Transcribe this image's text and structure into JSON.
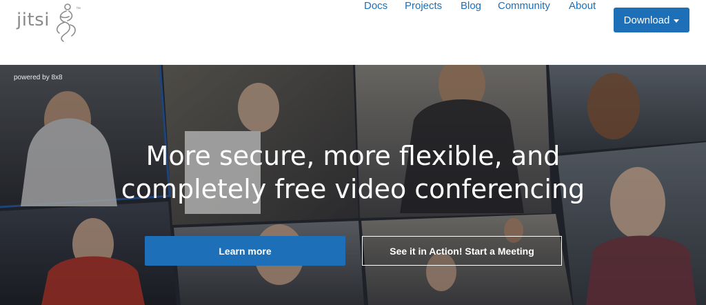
{
  "logo": {
    "text": "jitsi",
    "tm": "™"
  },
  "nav": {
    "items": [
      {
        "label": "Docs"
      },
      {
        "label": "Projects"
      },
      {
        "label": "Blog"
      },
      {
        "label": "Community"
      },
      {
        "label": "About"
      }
    ],
    "download_label": "Download"
  },
  "hero": {
    "powered_by": "powered by 8x8",
    "headline_line1": "More secure, more flexible, and",
    "headline_line2": "completely free video conferencing",
    "learn_more_label": "Learn more",
    "start_meeting_label": "See it in Action! Start a Meeting"
  },
  "colors": {
    "accent": "#1d6fb8",
    "logo_gray": "#8a8a8a"
  },
  "icons": {
    "logo_mark": "jitsi-figure-icon",
    "download_caret": "caret-down-icon"
  }
}
